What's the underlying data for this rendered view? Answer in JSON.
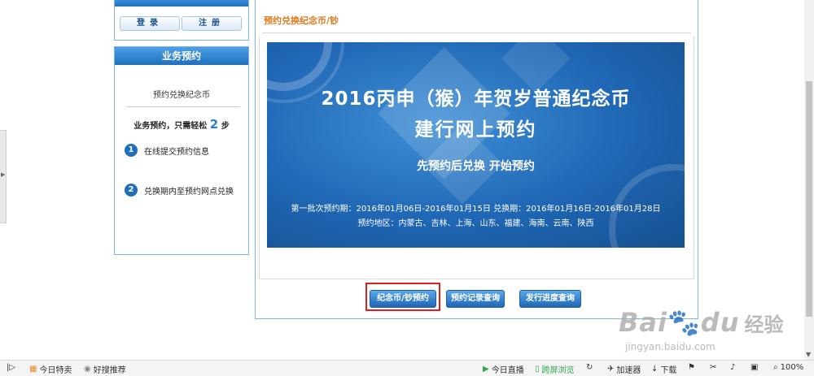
{
  "sidebar": {
    "login_box": {
      "login_label": "登录",
      "register_label": "注册"
    },
    "booking_panel": {
      "header": "业务预约",
      "subtitle": "预约兑换纪念币",
      "tagline_prefix": "业务预约，只需轻松",
      "tagline_number": "2",
      "tagline_suffix": "步",
      "steps": [
        {
          "number": "1",
          "label": "在线提交预约信息"
        },
        {
          "number": "2",
          "label": "兑换期内至预约网点兑换"
        }
      ]
    }
  },
  "main": {
    "title": "预约兑换纪念币/钞",
    "banner": {
      "headline1": "2016丙申（猴）年贺岁普通纪念币",
      "headline2": "建行网上预约",
      "slogan": "先预约后兑换   开始预约",
      "period": "第一批次预约期：2016年01月06日-2016年01月15日  兑换期：2016年01月16日-2016年01月28日",
      "region": "预约地区：内蒙古、吉林、上海、山东、福建、海南、云南、陕西"
    },
    "buttons": {
      "coin_booking": "纪念币/钞预约",
      "booking_records": "预约记录查询",
      "issue_progress": "发行进度查询"
    }
  },
  "watermark": {
    "logo": "Bai",
    "logo_suffix": "du",
    "cn": "经验",
    "url": "jingyan.baidu.com"
  },
  "statusbar": {
    "today_deals": "今日特卖",
    "good_search": "好搜推荐",
    "today_live": "今日直播",
    "cross_screen": "跨屏浏览",
    "accelerator": "加速器",
    "download": "下载",
    "zoom": "100%"
  },
  "colors": {
    "accent_blue": "#1f6fbd",
    "title_orange": "#e07a1e",
    "highlight_red": "#e02020"
  }
}
